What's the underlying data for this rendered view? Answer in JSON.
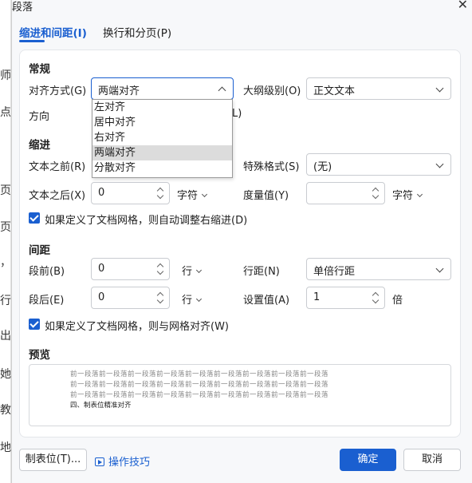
{
  "window": {
    "title": "段落",
    "close_glyph": "✕"
  },
  "tabs": [
    {
      "label": "缩进和间距(I)",
      "active": true
    },
    {
      "label": "换行和分页(P)",
      "active": false
    }
  ],
  "general": {
    "section": "常规",
    "align_label": "对齐方式(G)",
    "align_value": "两端对齐",
    "align_options": [
      "左对齐",
      "居中对齐",
      "右对齐",
      "两端对齐",
      "分散对齐"
    ],
    "align_highlighted": "两端对齐",
    "outline_label": "大纲级别(O)",
    "outline_value": "正文文本",
    "direction_label": "方向",
    "direction_partial": "L)"
  },
  "indent": {
    "section": "缩进",
    "before_label": "文本之前(R)",
    "special_label": "特殊格式(S)",
    "special_value": "(无)",
    "after_label": "文本之后(X)",
    "after_value": "0",
    "after_unit": "字符",
    "measure_label": "度量值(Y)",
    "measure_value": "",
    "measure_unit": "字符",
    "grid_check_label": "如果定义了文档网格，则自动调整右缩进(D)",
    "grid_checked": true
  },
  "spacing": {
    "section": "间距",
    "before_label": "段前(B)",
    "before_value": "0",
    "before_unit": "行",
    "line_label": "行距(N)",
    "line_value": "单倍行距",
    "after_label": "段后(E)",
    "after_value": "0",
    "after_unit": "行",
    "setvalue_label": "设置值(A)",
    "setvalue_value": "1",
    "setvalue_unit": "倍",
    "grid_check_label": "如果定义了文档网格，则与网格对齐(W)",
    "grid_checked": true
  },
  "preview": {
    "section": "预览",
    "prev_lines": [
      "前一段落前一段落前一段落前一段落前一段落前一段落前一段落前一段落前一段落",
      "前一段落前一段落前一段落前一段落前一段落前一段落前一段落前一段落前一段落",
      "前一段落前一段落前一段落前一段落前一段落前一段落前一段落前一段落前一段落"
    ],
    "current_text": "四、制表位精准对齐"
  },
  "footer": {
    "tabs_button": "制表位(T)...",
    "tips_link": "操作技巧",
    "ok": "确定",
    "cancel": "取消"
  },
  "background_doc": {
    "chars": [
      "师",
      "点",
      "页",
      "页",
      "，",
      "行",
      "出",
      "她",
      "教",
      "地"
    ]
  },
  "colors": {
    "accent": "#1a5fd0",
    "panel_bg": "#ffffff",
    "dialog_bg": "#f7f8fa"
  }
}
